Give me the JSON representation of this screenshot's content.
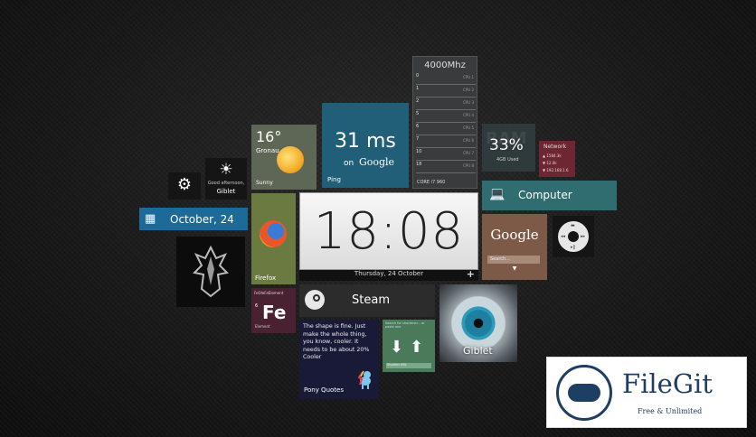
{
  "cpu": {
    "frequency": "4000Mhz",
    "cores": [
      {
        "num": "0",
        "label": "CPU 1"
      },
      {
        "num": "1",
        "label": "CPU 2"
      },
      {
        "num": "2",
        "label": "CPU 3"
      },
      {
        "num": "5",
        "label": "CPU 4"
      },
      {
        "num": "6",
        "label": "CPU 5"
      },
      {
        "num": "7",
        "label": "CPU 6"
      },
      {
        "num": "10",
        "label": "CPU 7"
      },
      {
        "num": "18",
        "label": "CPU 8"
      }
    ],
    "model": "CORE i7 960"
  },
  "ram": {
    "bg_label": "RAM",
    "percent": "33%",
    "used": "4GB Used"
  },
  "network": {
    "title": "Network",
    "lines": [
      "▲ 1584.3k",
      "▼ 12.0k",
      "▼ 192.168.1.6"
    ]
  },
  "ping": {
    "value": "31 ms",
    "on": "on",
    "service": "Google",
    "label": "Ping"
  },
  "weather": {
    "temp": "16°",
    "city": "Gronau",
    "condition": "Sunny"
  },
  "greeting": {
    "text": "Good afternoon,",
    "name": "Giblet"
  },
  "date_tile": {
    "text": "October, 24"
  },
  "clock": {
    "time": "18:08",
    "date": "Thursday, 24 October",
    "plus": "+"
  },
  "computer": {
    "label": "Computer"
  },
  "google": {
    "label": "Google",
    "search_placeholder": "Search..."
  },
  "firefox": {
    "label": "Firefox"
  },
  "periodic": {
    "header": "FeOleFeElement",
    "number": "6",
    "symbol": "Fe",
    "name": "Element"
  },
  "steam": {
    "label": "Steam"
  },
  "pony": {
    "quote": "The shape is fine. Just make the whole thing, you know, cooler. It needs to be about 20% Cooler",
    "label": "Pony Quotes"
  },
  "url_tile": {
    "top_text": "Search for shortener... or paste one",
    "bar_text": "Shorten URL"
  },
  "giblet": {
    "label": "Giblet"
  },
  "watermark": {
    "brand": "FileGit",
    "tagline": "Free & Unlimited"
  }
}
